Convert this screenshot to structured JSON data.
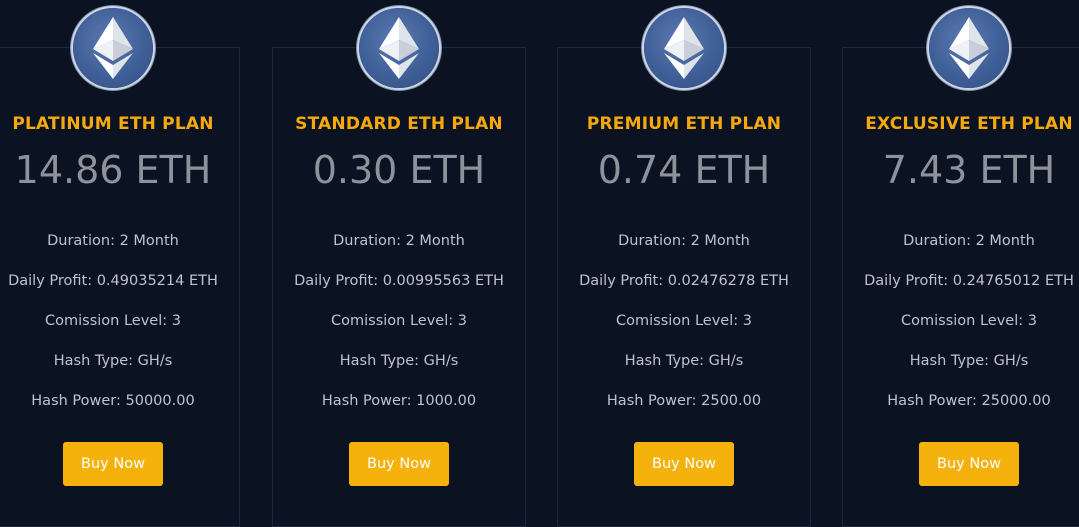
{
  "plans": [
    {
      "title": "PLATINUM ETH PLAN",
      "price": "14.86 ETH",
      "details": [
        "Duration: 2 Month",
        "Daily Profit: 0.49035214 ETH",
        "Comission Level: 3",
        "Hash Type: GH/s",
        "Hash Power: 50000.00"
      ],
      "button": "Buy Now"
    },
    {
      "title": "STANDARD ETH PLAN",
      "price": "0.30 ETH",
      "details": [
        "Duration: 2 Month",
        "Daily Profit: 0.00995563 ETH",
        "Comission Level: 3",
        "Hash Type: GH/s",
        "Hash Power: 1000.00"
      ],
      "button": "Buy Now"
    },
    {
      "title": "PREMIUM ETH PLAN",
      "price": "0.74 ETH",
      "details": [
        "Duration: 2 Month",
        "Daily Profit: 0.02476278 ETH",
        "Comission Level: 3",
        "Hash Type: GH/s",
        "Hash Power: 2500.00"
      ],
      "button": "Buy Now"
    },
    {
      "title": "EXCLUSIVE ETH PLAN",
      "price": "7.43 ETH",
      "details": [
        "Duration: 2 Month",
        "Daily Profit: 0.24765012 ETH",
        "Comission Level: 3",
        "Hash Type: GH/s",
        "Hash Power: 25000.00"
      ],
      "button": "Buy Now"
    }
  ],
  "colors": {
    "background": "#0b1221",
    "title": "#f5a90f",
    "button": "#f5b20d",
    "price": "#8e929a",
    "badge": "#3f5f98"
  },
  "icons": {
    "plan_badge": "ethereum-icon"
  }
}
